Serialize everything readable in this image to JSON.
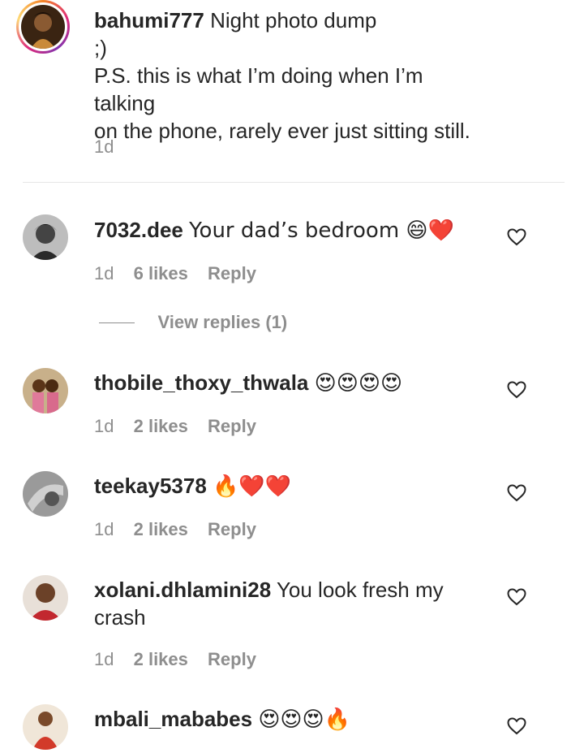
{
  "post_caption": {
    "username": "bahumi777",
    "text_line1": "Night photo dump",
    "text_line2": ";)",
    "text_line3": "P.S. this is what I’m doing when I’m talking",
    "text_line4": "on the phone, rarely ever just sitting still.",
    "timestamp": "1d"
  },
  "view_replies_label": "View replies (1)",
  "comments": [
    {
      "username": "7032.dee",
      "text": "Your dad’s bedroom 😄❤️",
      "timestamp": "1d",
      "likes": "6 likes",
      "reply": "Reply"
    },
    {
      "username": "thobile_thoxy_thwala",
      "text": "😍😍😍😍",
      "timestamp": "1d",
      "likes": "2 likes",
      "reply": "Reply"
    },
    {
      "username": "teekay5378",
      "text": "🔥❤️❤️",
      "timestamp": "1d",
      "likes": "2 likes",
      "reply": "Reply"
    },
    {
      "username": "xolani.dhlamini28",
      "text_line1": "You look fresh my",
      "text_line2": "crash",
      "timestamp": "1d",
      "likes": "2 likes",
      "reply": "Reply"
    },
    {
      "username": "mbali_mababes",
      "text": "😍😍😍🔥"
    }
  ],
  "icons": {
    "like": "heart-outline-icon"
  },
  "colors": {
    "text": "#262626",
    "secondary": "#8e8e8e",
    "divider": "#e6e6e6"
  }
}
